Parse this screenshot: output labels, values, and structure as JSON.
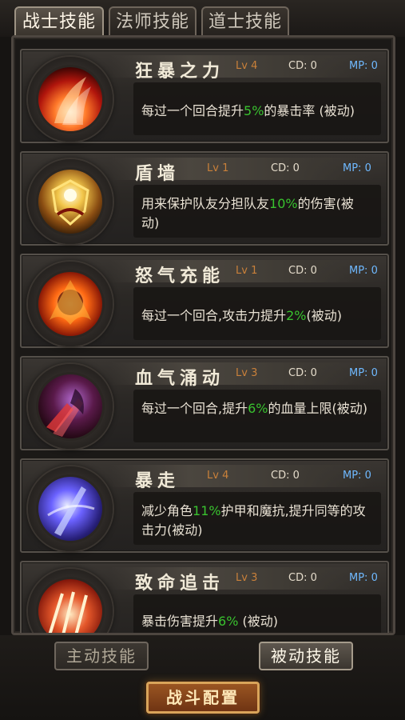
{
  "tabs": [
    {
      "label": "战士技能",
      "active": true
    },
    {
      "label": "法师技能",
      "active": false
    },
    {
      "label": "道士技能",
      "active": false
    }
  ],
  "skills": [
    {
      "name": "狂暴之力",
      "level": "Lv 4",
      "cd": "CD: 0",
      "mp": "MP: 0",
      "desc_pre": "每过一个回合提升",
      "desc_hl": "5%",
      "desc_post": "的暴击率 (被动)",
      "icon": "fury-flame-icon"
    },
    {
      "name": "盾墙",
      "level": "Lv 1",
      "cd": "CD: 0",
      "mp": "MP: 0",
      "desc_pre": "用来保护队友分担队友",
      "desc_hl": "10%",
      "desc_post": "的伤害(被动)",
      "icon": "golden-shield-icon"
    },
    {
      "name": "怒气充能",
      "level": "Lv 1",
      "cd": "CD: 0",
      "mp": "MP: 0",
      "desc_pre": "每过一个回合,攻击力提升",
      "desc_hl": "2%",
      "desc_post": "(被动)",
      "icon": "rage-fire-icon"
    },
    {
      "name": "血气涌动",
      "level": "Lv 3",
      "cd": "CD: 0",
      "mp": "MP: 0",
      "desc_pre": "每过一个回合,提升",
      "desc_hl": "6%",
      "desc_post": "的血量上限(被动)",
      "icon": "blood-surge-icon"
    },
    {
      "name": "暴走",
      "level": "Lv 4",
      "cd": "CD: 0",
      "mp": "MP: 0",
      "desc_pre": "减少角色",
      "desc_hl": "11%",
      "desc_post": "护甲和魔抗,提升同等的攻击力(被动)",
      "icon": "rampage-blade-icon"
    },
    {
      "name": "致命追击",
      "level": "Lv 3",
      "cd": "CD: 0",
      "mp": "MP: 0",
      "desc_pre": "暴击伤害提升",
      "desc_hl": "6%",
      "desc_post": " (被动)",
      "icon": "lethal-strike-icon"
    }
  ],
  "bottom": {
    "active_btn": "主动技能",
    "passive_btn": "被动技能",
    "battle_config": "战斗配置"
  },
  "colors": {
    "highlight": "#39c22f",
    "level": "#c9803a",
    "mp": "#6fb9ff"
  }
}
